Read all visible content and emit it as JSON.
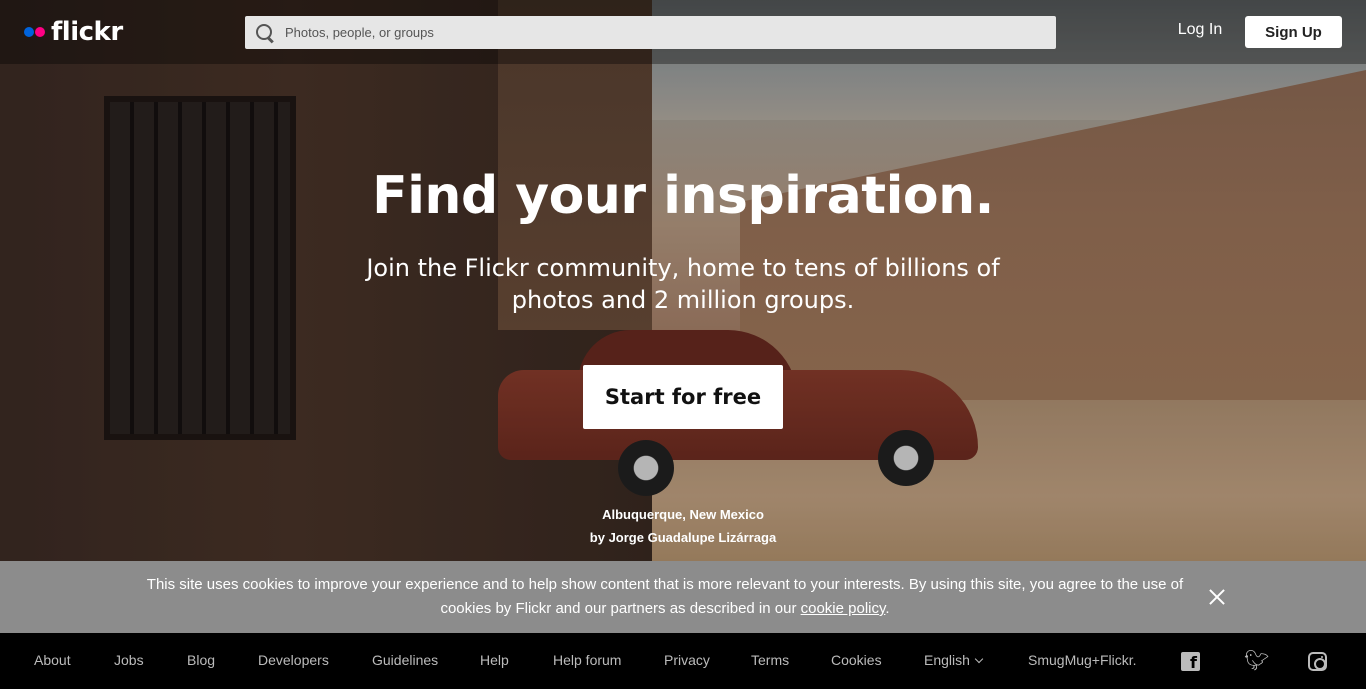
{
  "header": {
    "logo_text": "flickr",
    "logo_colors": {
      "blue": "#0063dc",
      "pink": "#ff0084"
    },
    "search_placeholder": "Photos, people, or groups",
    "login_label": "Log In",
    "signup_label": "Sign Up"
  },
  "hero": {
    "title": "Find your inspiration.",
    "subtitle": "Join the Flickr community, home to tens of billions of photos and 2 million groups.",
    "cta_label": "Start for free",
    "photo_location": "Albuquerque, New Mexico",
    "photo_credit": "by Jorge Guadalupe Lizárraga"
  },
  "cookie_banner": {
    "text": "This site uses cookies to improve your experience and to help show content that is more relevant to your interests. By using this site, you agree to the use of cookies by Flickr and our partners as described in our",
    "link_text": "cookie policy",
    "trailing": "."
  },
  "footer": {
    "links": [
      "About",
      "Jobs",
      "Blog",
      "Developers",
      "Guidelines",
      "Help",
      "Help forum",
      "Privacy",
      "Terms",
      "Cookies"
    ],
    "language": "English",
    "smugmug": "SmugMug+Flickr.",
    "social_icons": [
      "facebook-icon",
      "twitter-icon",
      "instagram-icon"
    ]
  }
}
